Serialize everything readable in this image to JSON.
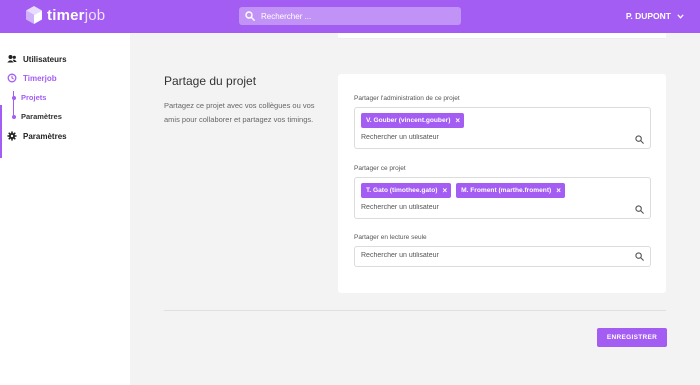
{
  "app": {
    "logo_bold": "timer",
    "logo_light": "job"
  },
  "header": {
    "search_placeholder": "Rechercher ...",
    "user_name": "P. DUPONT"
  },
  "sidebar": {
    "items": [
      {
        "label": "Utilisateurs",
        "icon": "users-icon"
      },
      {
        "label": "Timerjob",
        "icon": "clock-icon"
      },
      {
        "label": "Paramètres",
        "icon": "gear-icon"
      }
    ],
    "subitems": [
      {
        "label": "Projets"
      },
      {
        "label": "Paramètres"
      }
    ]
  },
  "main": {
    "section_title": "Partage du projet",
    "section_description": "Partagez ce projet avec vos collègues ou vos amis pour collaborer et partagez vos timings.",
    "fields": [
      {
        "label": "Partager l'administration de ce projet",
        "chips": [
          "V. Gouber (vincent.gouber)"
        ],
        "placeholder": "Rechercher un utilisateur"
      },
      {
        "label": "Partager ce projet",
        "chips": [
          "T. Gato (timothee.gato)",
          "M. Froment (marthe.froment)"
        ],
        "placeholder": "Rechercher un utilisateur"
      },
      {
        "label": "Partager en lecture seule",
        "chips": [],
        "placeholder": "Rechercher un utilisateur"
      }
    ],
    "chip_remove_symbol": "×",
    "save_label": "ENREGISTRER"
  },
  "colors": {
    "accent": "#a45df2",
    "background": "#f3f3f3"
  }
}
